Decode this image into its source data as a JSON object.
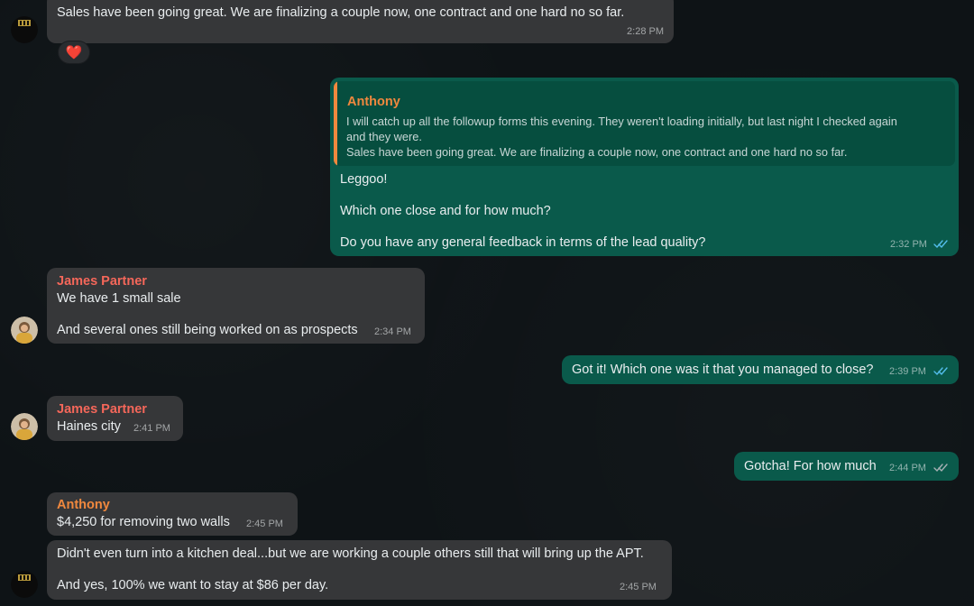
{
  "colors": {
    "background": "#0e1316",
    "incoming_bubble": "#363739",
    "outgoing_bubble": "#0a5a4b",
    "quote_bg": "#064e3f",
    "name_anthony": "#f0883e",
    "name_james": "#f5675a",
    "read_ticks": "#53bdeb",
    "sent_ticks": "#a7b0b4"
  },
  "messages": {
    "m1": {
      "text": "Sales have been going great. We are finalizing a couple now, one contract and one hard no so far.",
      "time": "2:28 PM",
      "reaction": "❤️"
    },
    "m2": {
      "quote_sender": "Anthony",
      "quote_line1": "I will catch up all the followup forms this evening. They weren't loading initially, but last night I checked again",
      "quote_line2": "and they were.",
      "quote_line3": "Sales have been going great. We are finalizing a couple now, one contract and one hard no so far.",
      "line1": "Leggoo!",
      "line2": "Which one close and for how much?",
      "line3": "Do you have any general feedback in terms of the lead quality?",
      "time": "2:32 PM",
      "status": "read"
    },
    "m3": {
      "sender": "James Partner",
      "line1": "We have 1 small sale",
      "line2": "And several ones still being worked on as prospects",
      "time": "2:34 PM"
    },
    "m4": {
      "text": "Got it! Which one was it that you managed to close?",
      "time": "2:39 PM",
      "status": "read"
    },
    "m5": {
      "sender": "James Partner",
      "text": "Haines city",
      "time": "2:41 PM"
    },
    "m6": {
      "text": "Gotcha! For how much",
      "time": "2:44 PM",
      "status": "delivered"
    },
    "m7": {
      "sender": "Anthony",
      "text": "$4,250 for removing two walls",
      "time": "2:45 PM"
    },
    "m8": {
      "line1": "Didn't even turn into a kitchen deal...but we are working a couple others still that will bring up the APT.",
      "line2": "And yes, 100% we want to stay at $86 per day.",
      "time": "2:45 PM"
    }
  }
}
